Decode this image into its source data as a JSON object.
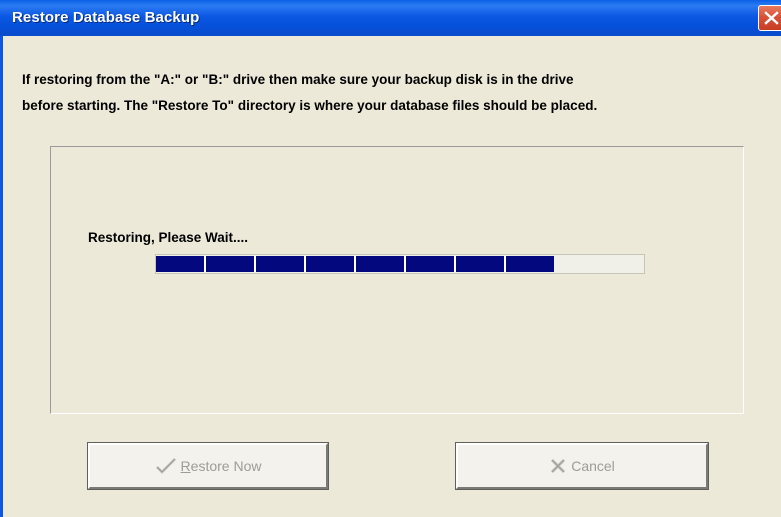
{
  "window": {
    "title": "Restore Database Backup",
    "close_icon": "close-x-icon",
    "accent_color": "#0a58e0"
  },
  "instructions": {
    "line1": "If restoring from the \"A:\" or \"B:\" drive then make sure your backup disk is in the drive",
    "line2": "before starting.  The \"Restore To\" directory is where your database files should be placed."
  },
  "progress": {
    "label": "Restoring, Please Wait....",
    "fraction": 0.815,
    "fill_color": "#04087e"
  },
  "buttons": {
    "restore": {
      "icon": "checkmark-icon",
      "mnemonic": "R",
      "rest": "estore Now",
      "enabled": false
    },
    "cancel": {
      "icon": "x-icon",
      "label": "Cancel",
      "enabled": false
    }
  }
}
